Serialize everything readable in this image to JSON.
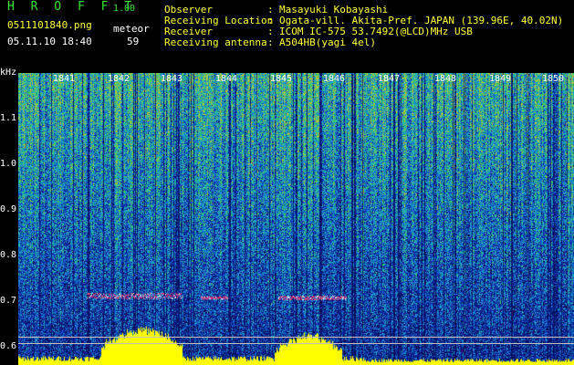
{
  "header": {
    "app_title": "H R O F F T",
    "version": "1.00",
    "filename": "0511101840.png",
    "mode": "meteor",
    "datetime": "05.11.10 18:40",
    "count": "59",
    "info": [
      {
        "label": "Observer",
        "value": "Masayuki Kobayashi"
      },
      {
        "label": "Receiving Location",
        "value": "Ogata-vill. Akita-Pref. JAPAN (139.96E, 40.02N)"
      },
      {
        "label": "Receiver",
        "value": "ICOM IC-575 53.7492(@LCD)MHz USB"
      },
      {
        "label": "Receiving antenna",
        "value": "A504HB(yagi 4el)"
      }
    ],
    "separator": ":"
  },
  "axis": {
    "unit": "kHz",
    "y_ticks": [
      "1.1",
      "1.0",
      "0.9",
      "0.8",
      "0.7",
      "0.6"
    ],
    "time_ticks": [
      "1841",
      "1842",
      "1843",
      "1844",
      "1845",
      "1846",
      "1847",
      "1848",
      "1849",
      "1850"
    ]
  },
  "colors": {
    "background": "#000000",
    "header_green": "#33e633",
    "header_yellow": "#ffff33",
    "text_white": "#ffffff",
    "spectrum_low": "#0a1a7a",
    "spectrum_mid": "#1f8bd6",
    "spectrum_high": "#33cc66",
    "echo": "#ff2a6a",
    "level_trace": "#ffff00"
  }
}
